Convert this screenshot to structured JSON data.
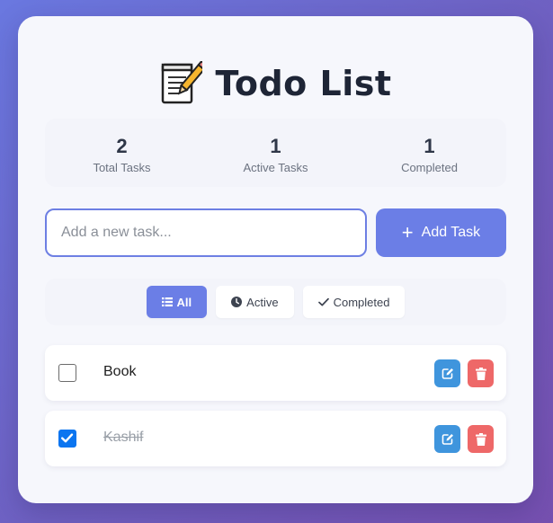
{
  "header": {
    "title": "Todo List",
    "icon": "memo-icon"
  },
  "stats": [
    {
      "value": "2",
      "label": "Total Tasks"
    },
    {
      "value": "1",
      "label": "Active Tasks"
    },
    {
      "value": "1",
      "label": "Completed"
    }
  ],
  "input": {
    "value": "",
    "placeholder": "Add a new task..."
  },
  "add_button": {
    "label": "Add Task",
    "icon": "plus-icon"
  },
  "filters": [
    {
      "label": "All",
      "icon": "list-icon",
      "active": true
    },
    {
      "label": "Active",
      "icon": "clock-icon",
      "active": false
    },
    {
      "label": "Completed",
      "icon": "check-icon",
      "active": false
    }
  ],
  "tasks": [
    {
      "text": "Book",
      "completed": false
    },
    {
      "text": "Kashif",
      "completed": true
    }
  ],
  "colors": {
    "accent": "#6b7ee6",
    "edit": "#3f95dd",
    "delete": "#ee6868",
    "checkbox_checked": "#0b75f0"
  }
}
